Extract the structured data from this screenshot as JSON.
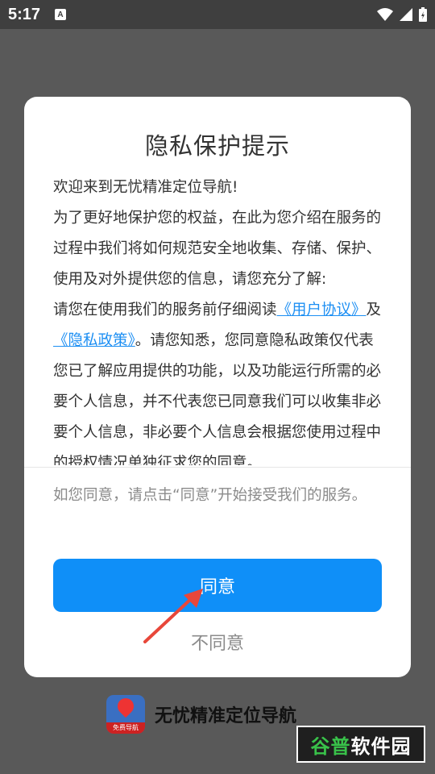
{
  "status_bar": {
    "time": "5:17",
    "notification_icon": "A",
    "icons": [
      "wifi-icon",
      "signal-icon",
      "battery-icon"
    ]
  },
  "dialog": {
    "title": "隐私保护提示",
    "body": {
      "welcome": "欢迎来到无忧精准定位导航!",
      "para1": "为了更好地保护您的权益，在此为您介绍在服务的过程中我们将如何规范安全地收集、存储、保护、使用及对外提供您的信息，请您充分了解:",
      "para2_prefix": "请您在使用我们的服务前仔细阅读",
      "user_agreement_link": "《用户协议》",
      "and": "及",
      "privacy_policy_link": "《隐私政策》",
      "para2_suffix": "。请您知悉，您同意隐私政策仅代表您已了解应用提供的功能，以及功能运行所需的必要个人信息，并不代表您已同意我们可以收集非必要个人信息，非必要个人信息会根据您使用过程中的授权情况单独征求您的同意。"
    },
    "notice": "如您同意，请点击“同意”开始接受我们的服务。",
    "agree_label": "同意",
    "disagree_label": "不同意"
  },
  "app": {
    "name": "无忧精准定位导航",
    "icon_badge": "免费导航"
  },
  "watermark": {
    "part1": "谷普",
    "part2": "软件园"
  },
  "colors": {
    "accent": "#0f8ff8",
    "link": "#1d8ff3",
    "arrow": "#e8473a",
    "backdrop": "#595959"
  }
}
